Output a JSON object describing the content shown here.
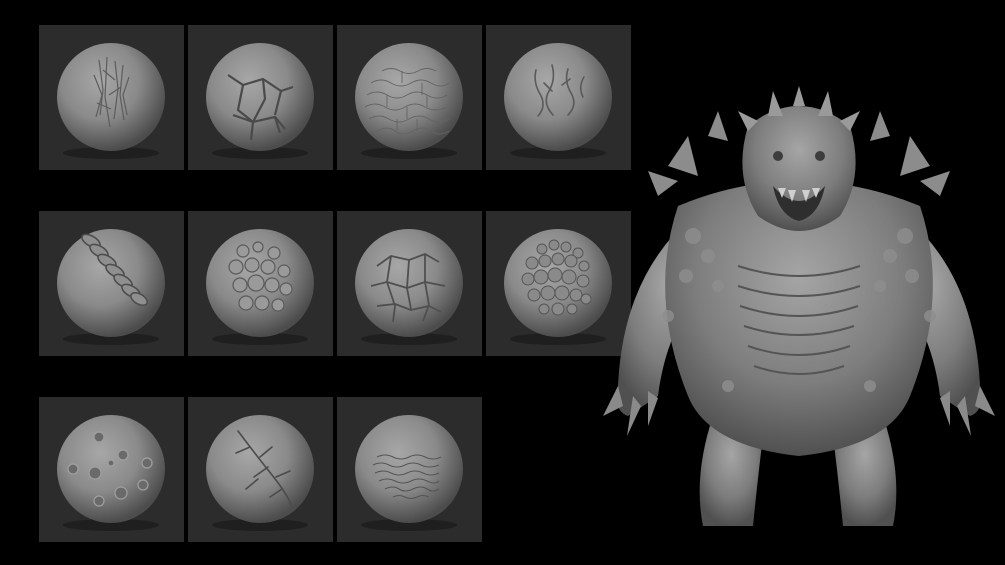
{
  "background_color": "#000000",
  "tile_color": "#2c2c2c",
  "brush_grid": {
    "rows": [
      {
        "tiles": [
          {
            "pattern": "fibrous-scratches"
          },
          {
            "pattern": "cracked-plates"
          },
          {
            "pattern": "fine-crackle"
          },
          {
            "pattern": "vein-lines"
          }
        ]
      },
      {
        "tiles": [
          {
            "pattern": "ridged-coil"
          },
          {
            "pattern": "bumpy-scales"
          },
          {
            "pattern": "cracked-hex-scales"
          },
          {
            "pattern": "dense-scales"
          }
        ]
      },
      {
        "tiles": [
          {
            "pattern": "crater-bumps"
          },
          {
            "pattern": "branching-veins"
          },
          {
            "pattern": "wrinkled-skin"
          }
        ]
      }
    ]
  },
  "preview": {
    "subject": "sculpted-monster",
    "color": "#7d7d7d"
  }
}
